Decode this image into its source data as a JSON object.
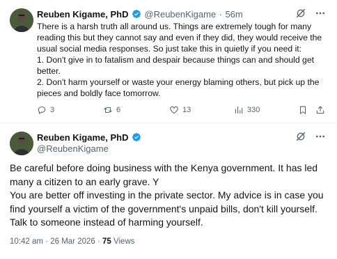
{
  "tweet1": {
    "author_name": "Reuben Kigame, PhD",
    "handle": "@ReubenKigame",
    "separator": "·",
    "time_ago": "56m",
    "body_lines": [
      "There is a harsh truth all around us. Things are extremely tough for many reading this but they cannot say and even if they did, they would receive the usual social media responses. So just take this in quietly if you need it:",
      "1. Don't give in to fatalism and despair because things can and should get better.",
      "2. Don't harm yourself or waste your energy blaming others, but pick up the pieces and boldly face tomorrow."
    ],
    "replies": "3",
    "reposts": "6",
    "likes": "13",
    "views": "330",
    "icons": [
      "grok-icon",
      "more-icon",
      "reply-icon",
      "repost-icon",
      "like-icon",
      "views-icon",
      "bookmark-icon",
      "share-icon"
    ]
  },
  "tweet2": {
    "author_name": "Reuben Kigame, PhD",
    "handle": "@ReubenKigame",
    "body_lines": [
      "Be careful before doing business with the Kenya government. It has led many a citizen to an early grave. Y",
      "You are better off investing in the private sector. My advice is in case you find yourself a victim of the government's unpaid bills, don't kill yourself. Talk to someone instead of harming yourself."
    ],
    "time": "10:42 am",
    "separator": "·",
    "date": "26 Mar 2026",
    "views_count": "75",
    "views_label": "Views"
  },
  "colors": {
    "text": "#0f1419",
    "muted": "#536471",
    "verified": "#1d9bf0",
    "divider": "#eff3f4"
  }
}
